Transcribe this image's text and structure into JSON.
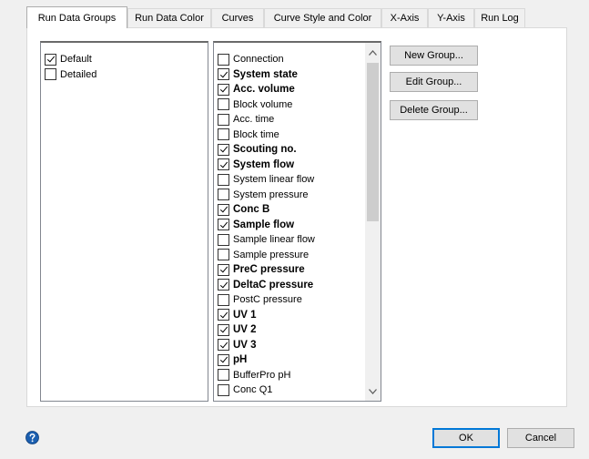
{
  "tabs": [
    {
      "label": "Run Data Groups",
      "active": true
    },
    {
      "label": "Run Data Color"
    },
    {
      "label": "Curves"
    },
    {
      "label": "Curve Style and Color"
    },
    {
      "label": "X-Axis"
    },
    {
      "label": "Y-Axis"
    },
    {
      "label": "Run Log"
    }
  ],
  "groups": [
    {
      "label": "Default",
      "checked": true
    },
    {
      "label": "Detailed",
      "checked": false
    }
  ],
  "columns": [
    {
      "label": "Connection",
      "checked": false,
      "bold": false
    },
    {
      "label": "System state",
      "checked": true,
      "bold": true
    },
    {
      "label": "Acc. volume",
      "checked": true,
      "bold": true
    },
    {
      "label": "Block volume",
      "checked": false,
      "bold": false
    },
    {
      "label": "Acc. time",
      "checked": false,
      "bold": false
    },
    {
      "label": "Block time",
      "checked": false,
      "bold": false
    },
    {
      "label": "Scouting no.",
      "checked": true,
      "bold": true
    },
    {
      "label": "System flow",
      "checked": true,
      "bold": true
    },
    {
      "label": "System linear flow",
      "checked": false,
      "bold": false
    },
    {
      "label": "System pressure",
      "checked": false,
      "bold": false
    },
    {
      "label": "Conc B",
      "checked": true,
      "bold": true
    },
    {
      "label": "Sample flow",
      "checked": true,
      "bold": true
    },
    {
      "label": "Sample linear flow",
      "checked": false,
      "bold": false
    },
    {
      "label": "Sample pressure",
      "checked": false,
      "bold": false
    },
    {
      "label": "PreC pressure",
      "checked": true,
      "bold": true
    },
    {
      "label": "DeltaC pressure",
      "checked": true,
      "bold": true
    },
    {
      "label": "PostC pressure",
      "checked": false,
      "bold": false
    },
    {
      "label": "UV 1",
      "checked": true,
      "bold": true
    },
    {
      "label": "UV 2",
      "checked": true,
      "bold": true
    },
    {
      "label": "UV 3",
      "checked": true,
      "bold": true
    },
    {
      "label": "pH",
      "checked": true,
      "bold": true
    },
    {
      "label": "BufferPro pH",
      "checked": false,
      "bold": false
    },
    {
      "label": "Conc Q1",
      "checked": false,
      "bold": false
    }
  ],
  "group_buttons": {
    "new": "New Group...",
    "edit": "Edit Group...",
    "delete": "Delete Group..."
  },
  "dialog_buttons": {
    "ok": "OK",
    "cancel": "Cancel"
  },
  "icons": {
    "help": "help-icon",
    "scroll_up": "chevron-up-icon",
    "scroll_down": "chevron-down-icon"
  },
  "colors": {
    "help_blue": "#1b5fb0",
    "ok_border": "#0078d7"
  }
}
